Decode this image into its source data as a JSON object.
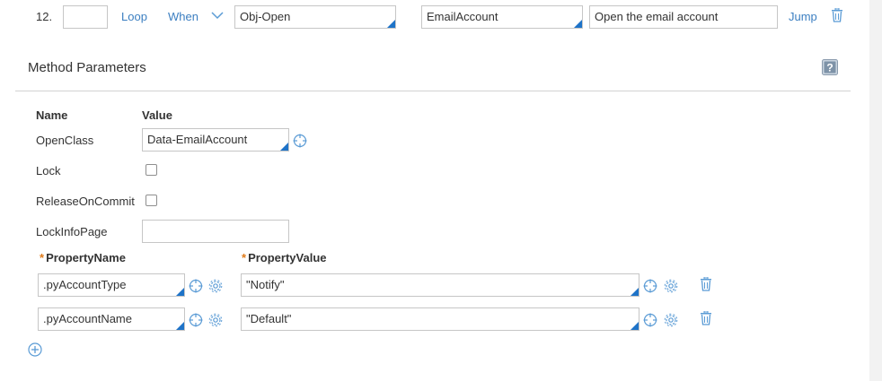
{
  "step": {
    "number": "12.",
    "label_value": "",
    "loop_label": "Loop",
    "when_label": "When",
    "method_value": "Obj-Open",
    "step_page_value": "EmailAccount",
    "description_value": "Open the email account",
    "jump_label": "Jump"
  },
  "section": {
    "title": "Method Parameters"
  },
  "params": {
    "name_header": "Name",
    "value_header": "Value",
    "openclass_label": "OpenClass",
    "openclass_value": "Data-EmailAccount",
    "lock_label": "Lock",
    "lock_checked": false,
    "release_label": "ReleaseOnCommit",
    "release_checked": false,
    "lockinfo_label": "LockInfoPage",
    "lockinfo_value": ""
  },
  "properties": {
    "required_marker": "*",
    "name_header": "PropertyName",
    "value_header": "PropertyValue",
    "rows": [
      {
        "name": ".pyAccountType",
        "value": "\"Notify\""
      },
      {
        "name": ".pyAccountName",
        "value": "\"Default\""
      }
    ]
  },
  "colors": {
    "link": "#3c7fc1",
    "corner": "#1e73c8",
    "required": "#e07b1a",
    "icon": "#5a9bd5"
  }
}
